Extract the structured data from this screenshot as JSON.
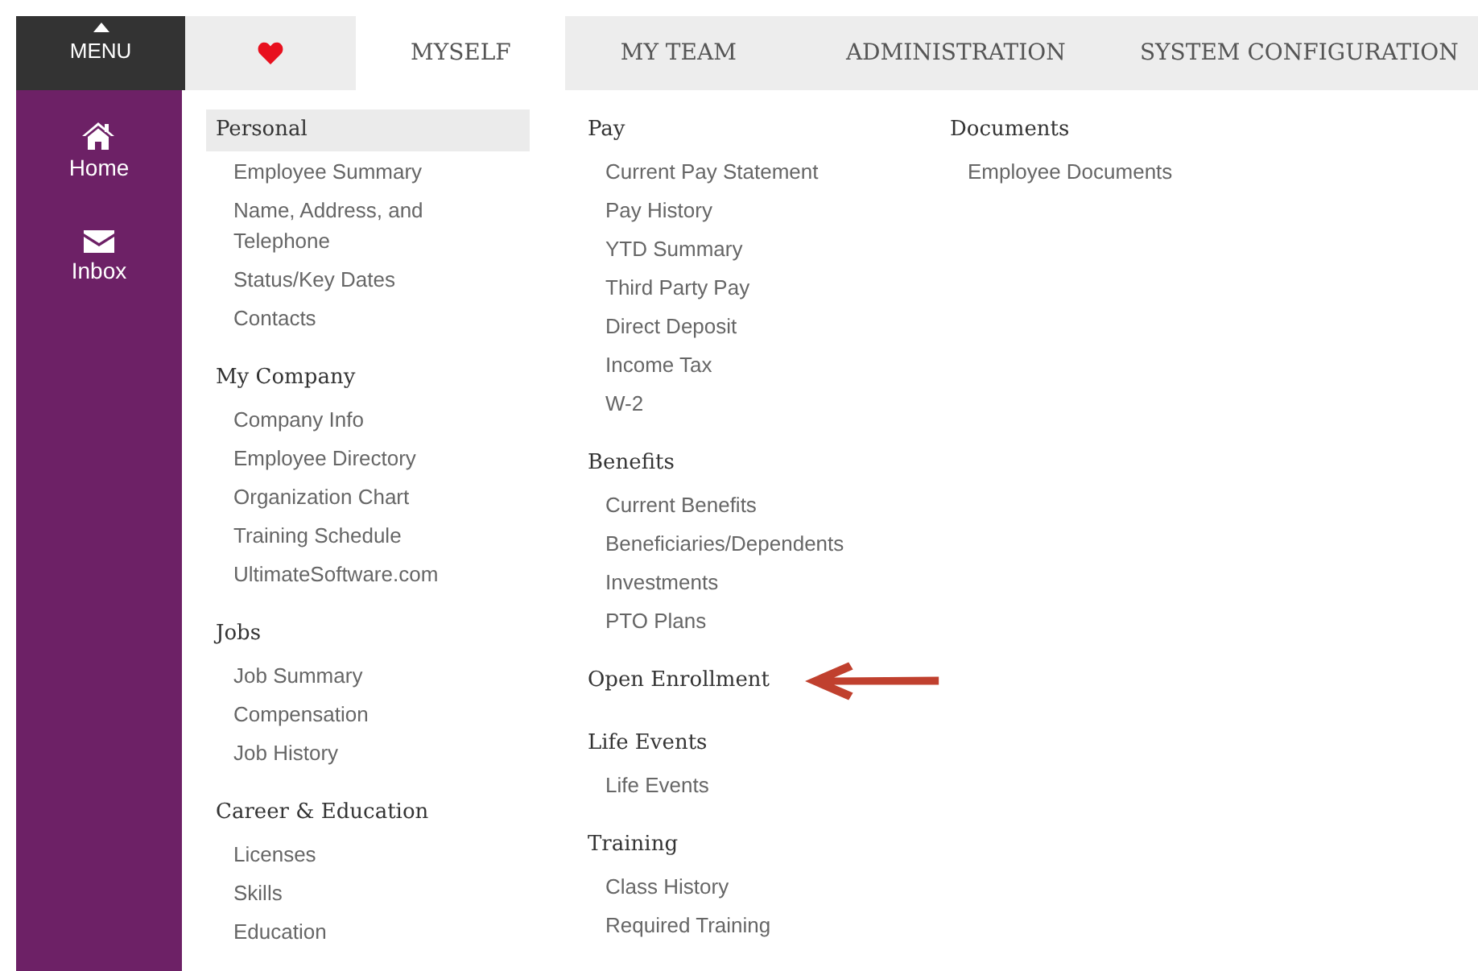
{
  "menu_button": {
    "label": "MENU"
  },
  "tabs": [
    {
      "kind": "favorite",
      "selected": false
    },
    {
      "kind": "text",
      "label": "MYSELF",
      "selected": true
    },
    {
      "kind": "text",
      "label": "MY TEAM",
      "selected": false
    },
    {
      "kind": "text",
      "label": "ADMINISTRATION",
      "selected": false
    },
    {
      "kind": "text",
      "label": "SYSTEM CONFIGURATION",
      "selected": false
    }
  ],
  "sidebar": {
    "items": [
      {
        "kind": "home",
        "label": "Home"
      },
      {
        "kind": "inbox",
        "label": "Inbox"
      }
    ]
  },
  "columns": [
    [
      {
        "title": "Personal",
        "highlighted": true,
        "items": [
          "Employee Summary",
          "Name, Address, and Telephone",
          "Status/Key Dates",
          "Contacts"
        ]
      },
      {
        "title": "My Company",
        "highlighted": false,
        "items": [
          "Company Info",
          "Employee Directory",
          "Organization Chart",
          "Training Schedule",
          "UltimateSoftware.com"
        ]
      },
      {
        "title": "Jobs",
        "highlighted": false,
        "items": [
          "Job Summary",
          "Compensation",
          "Job History"
        ]
      },
      {
        "title": "Career & Education",
        "highlighted": false,
        "items": [
          "Licenses",
          "Skills",
          "Education"
        ]
      }
    ],
    [
      {
        "title": "Pay",
        "highlighted": false,
        "items": [
          "Current Pay Statement",
          "Pay History",
          "YTD Summary",
          "Third Party Pay",
          "Direct Deposit",
          "Income Tax",
          "W-2"
        ]
      },
      {
        "title": "Benefits",
        "highlighted": false,
        "items": [
          "Current Benefits",
          "Beneficiaries/Dependents",
          "Investments",
          "PTO Plans"
        ]
      },
      {
        "title": "Open Enrollment",
        "highlighted": false,
        "arrow": true
      },
      {
        "title": "Life Events",
        "highlighted": false,
        "items": [
          "Life Events"
        ]
      },
      {
        "title": "Training",
        "highlighted": false,
        "items": [
          "Class History",
          "Required Training"
        ]
      }
    ],
    [
      {
        "title": "Documents",
        "highlighted": false,
        "items": [
          "Employee Documents"
        ]
      }
    ]
  ]
}
